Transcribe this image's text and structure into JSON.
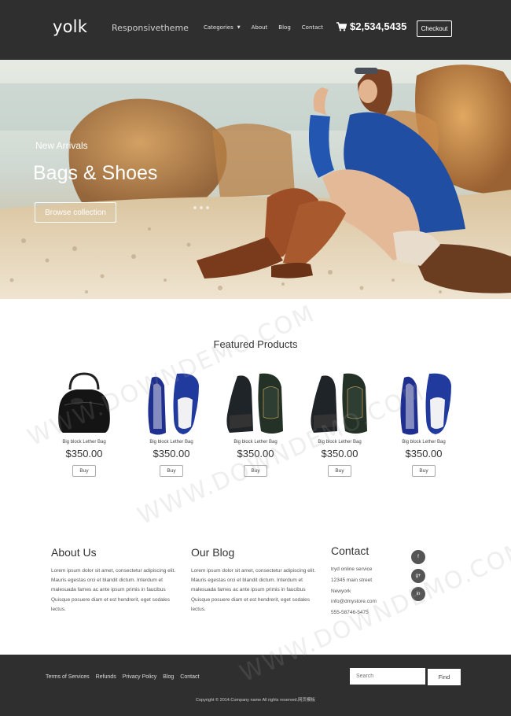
{
  "header": {
    "logo": "yolk",
    "tagline": "Responsivetheme",
    "nav": [
      {
        "label": "Categories",
        "dropdown": true
      },
      {
        "label": "About"
      },
      {
        "label": "Blog"
      },
      {
        "label": "Contact"
      }
    ],
    "cart_total": "$2,534,5435",
    "checkout_label": "Checkout",
    "background": "#2f2f2f"
  },
  "hero": {
    "subtitle": "New Arrivals",
    "title": "Bags & Shoes",
    "button_label": "Browse collection"
  },
  "featured": {
    "title": "Featured Products",
    "products": [
      {
        "name": "Big block Lether Bag",
        "price": "$350.00",
        "buy_label": "Buy",
        "image": "black-handbag"
      },
      {
        "name": "Big block Lether Bag",
        "price": "$350.00",
        "buy_label": "Buy",
        "image": "blue-loafers"
      },
      {
        "name": "Big block Lether Bag",
        "price": "$350.00",
        "buy_label": "Buy",
        "image": "dark-sneakers"
      },
      {
        "name": "Big block Lether Bag",
        "price": "$350.00",
        "buy_label": "Buy",
        "image": "dark-sneakers"
      },
      {
        "name": "Big block Lether Bag",
        "price": "$350.00",
        "buy_label": "Buy",
        "image": "blue-loafers"
      }
    ]
  },
  "about": {
    "title": "About Us",
    "text": "Lorem ipsum dolor sit amet, consectetur adipiscing elit. Mauris egestas orci et blandit dictum. Interdum et malesuada fames ac ante ipsum primis in faucibus Quisque posuere diam et est hendrerit, eget sodales lectus."
  },
  "blog": {
    "title": "Our Blog",
    "text": "Lorem ipsum dolor sit amet, consectetur adipiscing elit. Mauris egestas orci et blandit dictum. Interdum et malesuada fames ac ante ipsum primis in faucibus Quisque posuere diam et est hendrerit, eget sodales lectus."
  },
  "contact": {
    "title": "Contact",
    "lines": [
      "tryd online service",
      "12345 main street",
      "Newyork",
      "info@dmystore.com",
      "555-58746-5475"
    ],
    "social": [
      {
        "label": "f",
        "icon": "facebook-icon"
      },
      {
        "label": "g+",
        "icon": "google-plus-icon"
      },
      {
        "label": "in",
        "icon": "linkedin-icon"
      }
    ]
  },
  "footer": {
    "links": [
      "Terms of Services",
      "Refunds",
      "Privacy Policy",
      "Blog",
      "Contact"
    ],
    "search_placeholder": "Search",
    "find_label": "Find",
    "copyright": "Copyright © 2014.Company name All rights reserved.网页模板"
  },
  "watermark": "WWW.DOWNDEMO.COM"
}
